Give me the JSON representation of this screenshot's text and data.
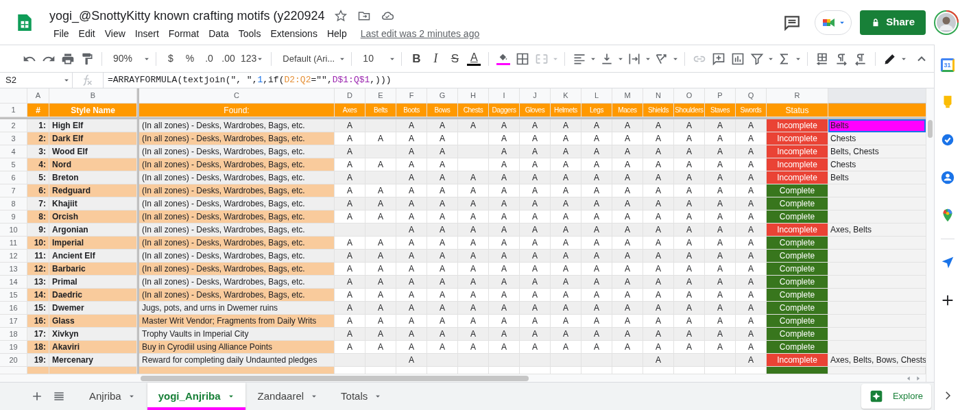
{
  "document": {
    "title": "yogi_@SnottyKitty known crafting motifs (y220924",
    "last_edit": "Last edit was 2 minutes ago"
  },
  "menu": [
    "File",
    "Edit",
    "View",
    "Insert",
    "Format",
    "Data",
    "Tools",
    "Extensions",
    "Help"
  ],
  "share_button": "Share",
  "toolbar": {
    "zoom": "90%",
    "currency": "$",
    "percent": "%",
    "decrease_decimals": ".0",
    "increase_decimals": ".00",
    "number_format": "123",
    "font": "Default (Ari...",
    "font_size": "10",
    "bold": "B",
    "italic": "I",
    "strikethrough": "S",
    "text_color": "A"
  },
  "formula_bar": {
    "cell": "S2",
    "parts": [
      {
        "text": "=ARRAYFORMULA(textjoin(\", \",",
        "color": "#202124"
      },
      {
        "text": "1",
        "color": "#1a73e8"
      },
      {
        "text": ",if(",
        "color": "#202124"
      },
      {
        "text": "D2:Q2",
        "color": "#e69138"
      },
      {
        "text": "=\"\",",
        "color": "#202124"
      },
      {
        "text": "D$1:Q$1",
        "color": "#9c27b0"
      },
      {
        "text": ",)))",
        "color": "#202124"
      }
    ]
  },
  "column_letters": [
    "A",
    "B",
    "C",
    "D",
    "E",
    "F",
    "G",
    "H",
    "I",
    "J",
    "K",
    "L",
    "M",
    "N",
    "O",
    "P",
    "Q",
    "R"
  ],
  "header_row": {
    "row_number": "1",
    "number": "#",
    "style_name": "Style Name",
    "found": "Found:",
    "items": [
      "Axes",
      "Belts",
      "Boots",
      "Bows",
      "Chests",
      "Daggers",
      "Gloves",
      "Helmets",
      "Legs",
      "Maces",
      "Shields",
      "Shoulders",
      "Staves",
      "Swords"
    ],
    "status": "Status"
  },
  "rows": [
    {
      "row_number": "2",
      "number": "1:",
      "style_name": "High Elf",
      "found": "(In all zones) - Desks, Wardrobes, Bags, etc.",
      "cells": [
        "A",
        null,
        "A",
        "A",
        "A",
        "A",
        "A",
        "A",
        "A",
        "A",
        "A",
        "A",
        "A",
        "A"
      ],
      "status": {
        "kind": "incomplete",
        "text": "Incomplete"
      },
      "column_19": "Belts",
      "column_19_selected": true,
      "column_19_highlighted": true
    },
    {
      "row_number": "3",
      "number": "2:",
      "style_name": "Dark Elf",
      "found": "(In all zones) - Desks, Wardrobes, Bags, etc.",
      "cells": [
        "A",
        "A",
        "A",
        "A",
        null,
        "A",
        "A",
        "A",
        "A",
        "A",
        "A",
        "A",
        "A",
        "A"
      ],
      "status": {
        "kind": "incomplete",
        "text": "Incomplete"
      },
      "column_19": "Chests",
      "column_19_selected": false,
      "column_19_highlighted": false
    },
    {
      "row_number": "4",
      "number": "3:",
      "style_name": "Wood Elf",
      "found": "(In all zones) - Desks, Wardrobes, Bags, etc.",
      "cells": [
        "A",
        null,
        "A",
        "A",
        null,
        "A",
        "A",
        "A",
        "A",
        "A",
        "A",
        "A",
        "A",
        "A"
      ],
      "status": {
        "kind": "incomplete",
        "text": "Incomplete"
      },
      "column_19": "Belts, Chests",
      "column_19_selected": false,
      "column_19_highlighted": false
    },
    {
      "row_number": "5",
      "number": "4:",
      "style_name": "Nord",
      "found": "(In all zones) - Desks, Wardrobes, Bags, etc.",
      "cells": [
        "A",
        "A",
        "A",
        "A",
        null,
        "A",
        "A",
        "A",
        "A",
        "A",
        "A",
        "A",
        "A",
        "A"
      ],
      "status": {
        "kind": "incomplete",
        "text": "Incomplete"
      },
      "column_19": "Chests",
      "column_19_selected": false,
      "column_19_highlighted": false
    },
    {
      "row_number": "6",
      "number": "5:",
      "style_name": "Breton",
      "found": "(In all zones) - Desks, Wardrobes, Bags, etc.",
      "cells": [
        "A",
        null,
        "A",
        "A",
        "A",
        "A",
        "A",
        "A",
        "A",
        "A",
        "A",
        "A",
        "A",
        "A"
      ],
      "status": {
        "kind": "incomplete",
        "text": "Incomplete"
      },
      "column_19": "Belts",
      "column_19_selected": false,
      "column_19_highlighted": false
    },
    {
      "row_number": "7",
      "number": "6:",
      "style_name": "Redguard",
      "found": "(In all zones) - Desks, Wardrobes, Bags, etc.",
      "cells": [
        "A",
        "A",
        "A",
        "A",
        "A",
        "A",
        "A",
        "A",
        "A",
        "A",
        "A",
        "A",
        "A",
        "A"
      ],
      "status": {
        "kind": "complete",
        "text": "Complete"
      },
      "column_19_selected": false,
      "column_19_highlighted": false
    },
    {
      "row_number": "8",
      "number": "7:",
      "style_name": "Khajiit",
      "found": "(In all zones) - Desks, Wardrobes, Bags, etc.",
      "cells": [
        "A",
        "A",
        "A",
        "A",
        "A",
        "A",
        "A",
        "A",
        "A",
        "A",
        "A",
        "A",
        "A",
        "A"
      ],
      "status": {
        "kind": "complete",
        "text": "Complete"
      },
      "column_19_selected": false,
      "column_19_highlighted": false
    },
    {
      "row_number": "9",
      "number": "8:",
      "style_name": "Orcish",
      "found": "(In all zones) - Desks, Wardrobes, Bags, etc.",
      "cells": [
        "A",
        "A",
        "A",
        "A",
        "A",
        "A",
        "A",
        "A",
        "A",
        "A",
        "A",
        "A",
        "A",
        "A"
      ],
      "status": {
        "kind": "complete",
        "text": "Complete"
      },
      "column_19_selected": false,
      "column_19_highlighted": false
    },
    {
      "row_number": "10",
      "number": "9:",
      "style_name": "Argonian",
      "found": "(In all zones) - Desks, Wardrobes, Bags, etc.",
      "cells": [
        null,
        null,
        "A",
        "A",
        "A",
        "A",
        "A",
        "A",
        "A",
        "A",
        "A",
        "A",
        "A",
        "A"
      ],
      "status": {
        "kind": "incomplete",
        "text": "Incomplete"
      },
      "column_19": "Axes, Belts",
      "column_19_selected": false,
      "column_19_highlighted": false
    },
    {
      "row_number": "11",
      "number": "10:",
      "style_name": "Imperial",
      "found": "(In all zones) - Desks, Wardrobes, Bags, etc.",
      "cells": [
        "A",
        "A",
        "A",
        "A",
        "A",
        "A",
        "A",
        "A",
        "A",
        "A",
        "A",
        "A",
        "A",
        "A"
      ],
      "status": {
        "kind": "complete",
        "text": "Complete"
      },
      "column_19_selected": false,
      "column_19_highlighted": false
    },
    {
      "row_number": "12",
      "number": "11:",
      "style_name": "Ancient Elf",
      "found": "(In all zones) - Desks, Wardrobes, Bags, etc.",
      "cells": [
        "A",
        "A",
        "A",
        "A",
        "A",
        "A",
        "A",
        "A",
        "A",
        "A",
        "A",
        "A",
        "A",
        "A"
      ],
      "status": {
        "kind": "complete",
        "text": "Complete"
      },
      "column_19_selected": false,
      "column_19_highlighted": false
    },
    {
      "row_number": "13",
      "number": "12:",
      "style_name": "Barbaric",
      "found": "(In all zones) - Desks, Wardrobes, Bags, etc.",
      "cells": [
        "A",
        "A",
        "A",
        "A",
        "A",
        "A",
        "A",
        "A",
        "A",
        "A",
        "A",
        "A",
        "A",
        "A"
      ],
      "status": {
        "kind": "complete",
        "text": "Complete"
      },
      "column_19_selected": false,
      "column_19_highlighted": false
    },
    {
      "row_number": "14",
      "number": "13:",
      "style_name": "Primal",
      "found": "(In all zones) - Desks, Wardrobes, Bags, etc.",
      "cells": [
        "A",
        "A",
        "A",
        "A",
        "A",
        "A",
        "A",
        "A",
        "A",
        "A",
        "A",
        "A",
        "A",
        "A"
      ],
      "status": {
        "kind": "complete",
        "text": "Complete"
      },
      "column_19_selected": false,
      "column_19_highlighted": false
    },
    {
      "row_number": "15",
      "number": "14:",
      "style_name": "Daedric",
      "found": "(In all zones) - Desks, Wardrobes, Bags, etc.",
      "cells": [
        "A",
        "A",
        "A",
        "A",
        "A",
        "A",
        "A",
        "A",
        "A",
        "A",
        "A",
        "A",
        "A",
        "A"
      ],
      "status": {
        "kind": "complete",
        "text": "Complete"
      },
      "column_19_selected": false,
      "column_19_highlighted": false
    },
    {
      "row_number": "16",
      "number": "15:",
      "style_name": "Dwemer",
      "found": "Jugs, pots, and urns in Dwemer ruins",
      "cells": [
        "A",
        "A",
        "A",
        "A",
        "A",
        "A",
        "A",
        "A",
        "A",
        "A",
        "A",
        "A",
        "A",
        "A"
      ],
      "status": {
        "kind": "complete",
        "text": "Complete"
      },
      "column_19_selected": false,
      "column_19_highlighted": false
    },
    {
      "row_number": "17",
      "number": "16:",
      "style_name": "Glass",
      "found": "Master Writ Vendor; Fragments from Daily Writs",
      "cells": [
        "A",
        "A",
        "A",
        "A",
        "A",
        "A",
        "A",
        "A",
        "A",
        "A",
        "A",
        "A",
        "A",
        "A"
      ],
      "status": {
        "kind": "complete",
        "text": "Complete"
      },
      "column_19_selected": false,
      "column_19_highlighted": false
    },
    {
      "row_number": "18",
      "number": "17:",
      "style_name": "Xivkyn",
      "found": "Trophy Vaults in Imperial City",
      "cells": [
        "A",
        "A",
        "A",
        "A",
        "A",
        "A",
        "A",
        "A",
        "A",
        "A",
        "A",
        "A",
        "A",
        "A"
      ],
      "status": {
        "kind": "complete",
        "text": "Complete"
      },
      "column_19_selected": false,
      "column_19_highlighted": false
    },
    {
      "row_number": "19",
      "number": "18:",
      "style_name": "Akaviri",
      "found": "Buy in Cyrodiil using Alliance Points",
      "cells": [
        "A",
        "A",
        "A",
        "A",
        "A",
        "A",
        "A",
        "A",
        "A",
        "A",
        "A",
        "A",
        "A",
        "A"
      ],
      "status": {
        "kind": "complete",
        "text": "Complete"
      },
      "column_19_selected": false,
      "column_19_highlighted": false
    },
    {
      "row_number": "20",
      "number": "19:",
      "style_name": "Mercenary",
      "found": "Reward for completing daily Undaunted pledges",
      "cells": [
        null,
        null,
        "A",
        null,
        null,
        null,
        null,
        null,
        null,
        null,
        "A",
        null,
        null,
        "A"
      ],
      "status": {
        "kind": "incomplete",
        "text": "Incomplete"
      },
      "column_19": "Axes, Belts, Bows, Chests",
      "column_19_selected": false,
      "column_19_highlighted": false
    }
  ],
  "sheet_tabs": [
    {
      "label": "Anjriba",
      "selected": false
    },
    {
      "label": "yogi_Anjriba",
      "selected": true,
      "color": "#ff00ff"
    },
    {
      "label": "Zandaarel",
      "selected": false
    },
    {
      "label": "Totals",
      "selected": false
    }
  ],
  "explore_button": "Explore",
  "side_panel": {
    "calendar_day": "31"
  }
}
